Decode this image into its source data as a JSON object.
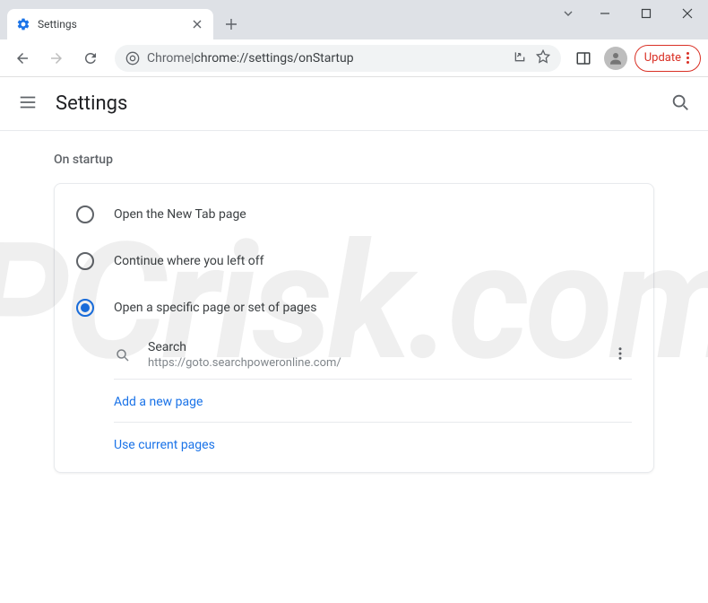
{
  "tab": {
    "title": "Settings"
  },
  "omnibox": {
    "prefix": "Chrome",
    "separator": " | ",
    "path": "chrome://settings/onStartup"
  },
  "update_button": {
    "label": "Update"
  },
  "header": {
    "title": "Settings"
  },
  "section": {
    "title": "On startup"
  },
  "options": [
    {
      "label": "Open the New Tab page",
      "selected": false
    },
    {
      "label": "Continue where you left off",
      "selected": false
    },
    {
      "label": "Open a specific page or set of pages",
      "selected": true
    }
  ],
  "startup_page": {
    "name": "Search",
    "url": "https://goto.searchpoweronline.com/"
  },
  "links": {
    "add_page": "Add a new page",
    "use_current": "Use current pages"
  },
  "watermark": "PCrisk.com"
}
